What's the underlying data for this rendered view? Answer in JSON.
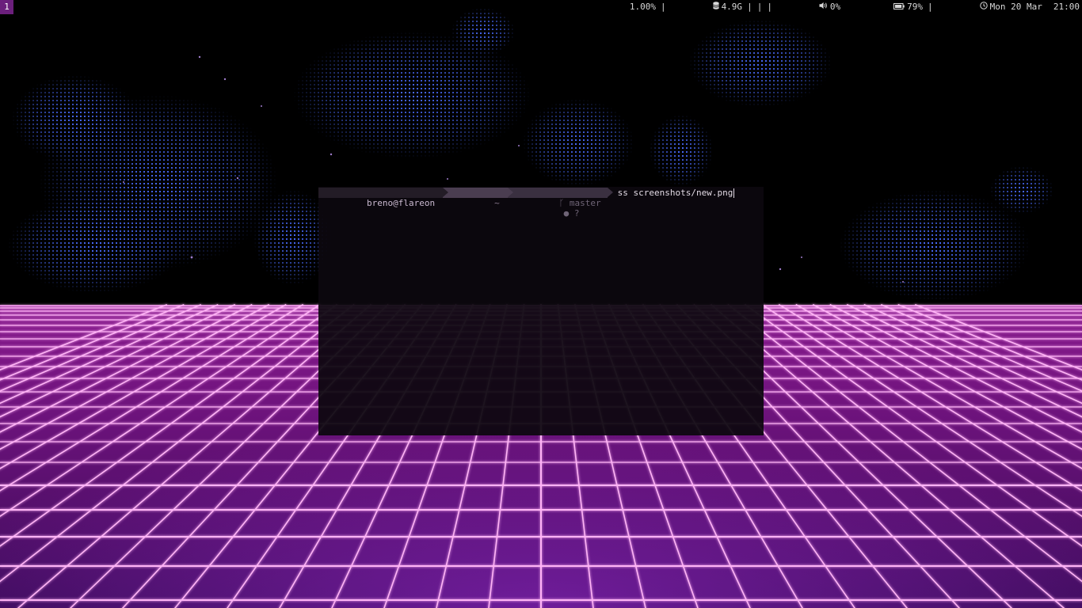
{
  "topbar": {
    "workspace": "1",
    "cpu": "1.00%",
    "disk": "4.9G",
    "volume": "0%",
    "battery": "79%",
    "date": "Mon 20 Mar",
    "time": "21:00",
    "separator": "|",
    "icons": {
      "disk": "database-icon",
      "volume": "speaker-icon",
      "battery": "battery-icon",
      "clock": "clock-icon"
    }
  },
  "terminal": {
    "user_host": "breno@flareon",
    "directory": "~",
    "git_branch": "master",
    "git_status": "● ?",
    "git_icon": "branch-icon",
    "command": "ss screenshots/new.png"
  },
  "colors": {
    "accent": "#6b1f7c",
    "grid_line": "#ff9cf3",
    "floor": "#3a0b4a"
  }
}
